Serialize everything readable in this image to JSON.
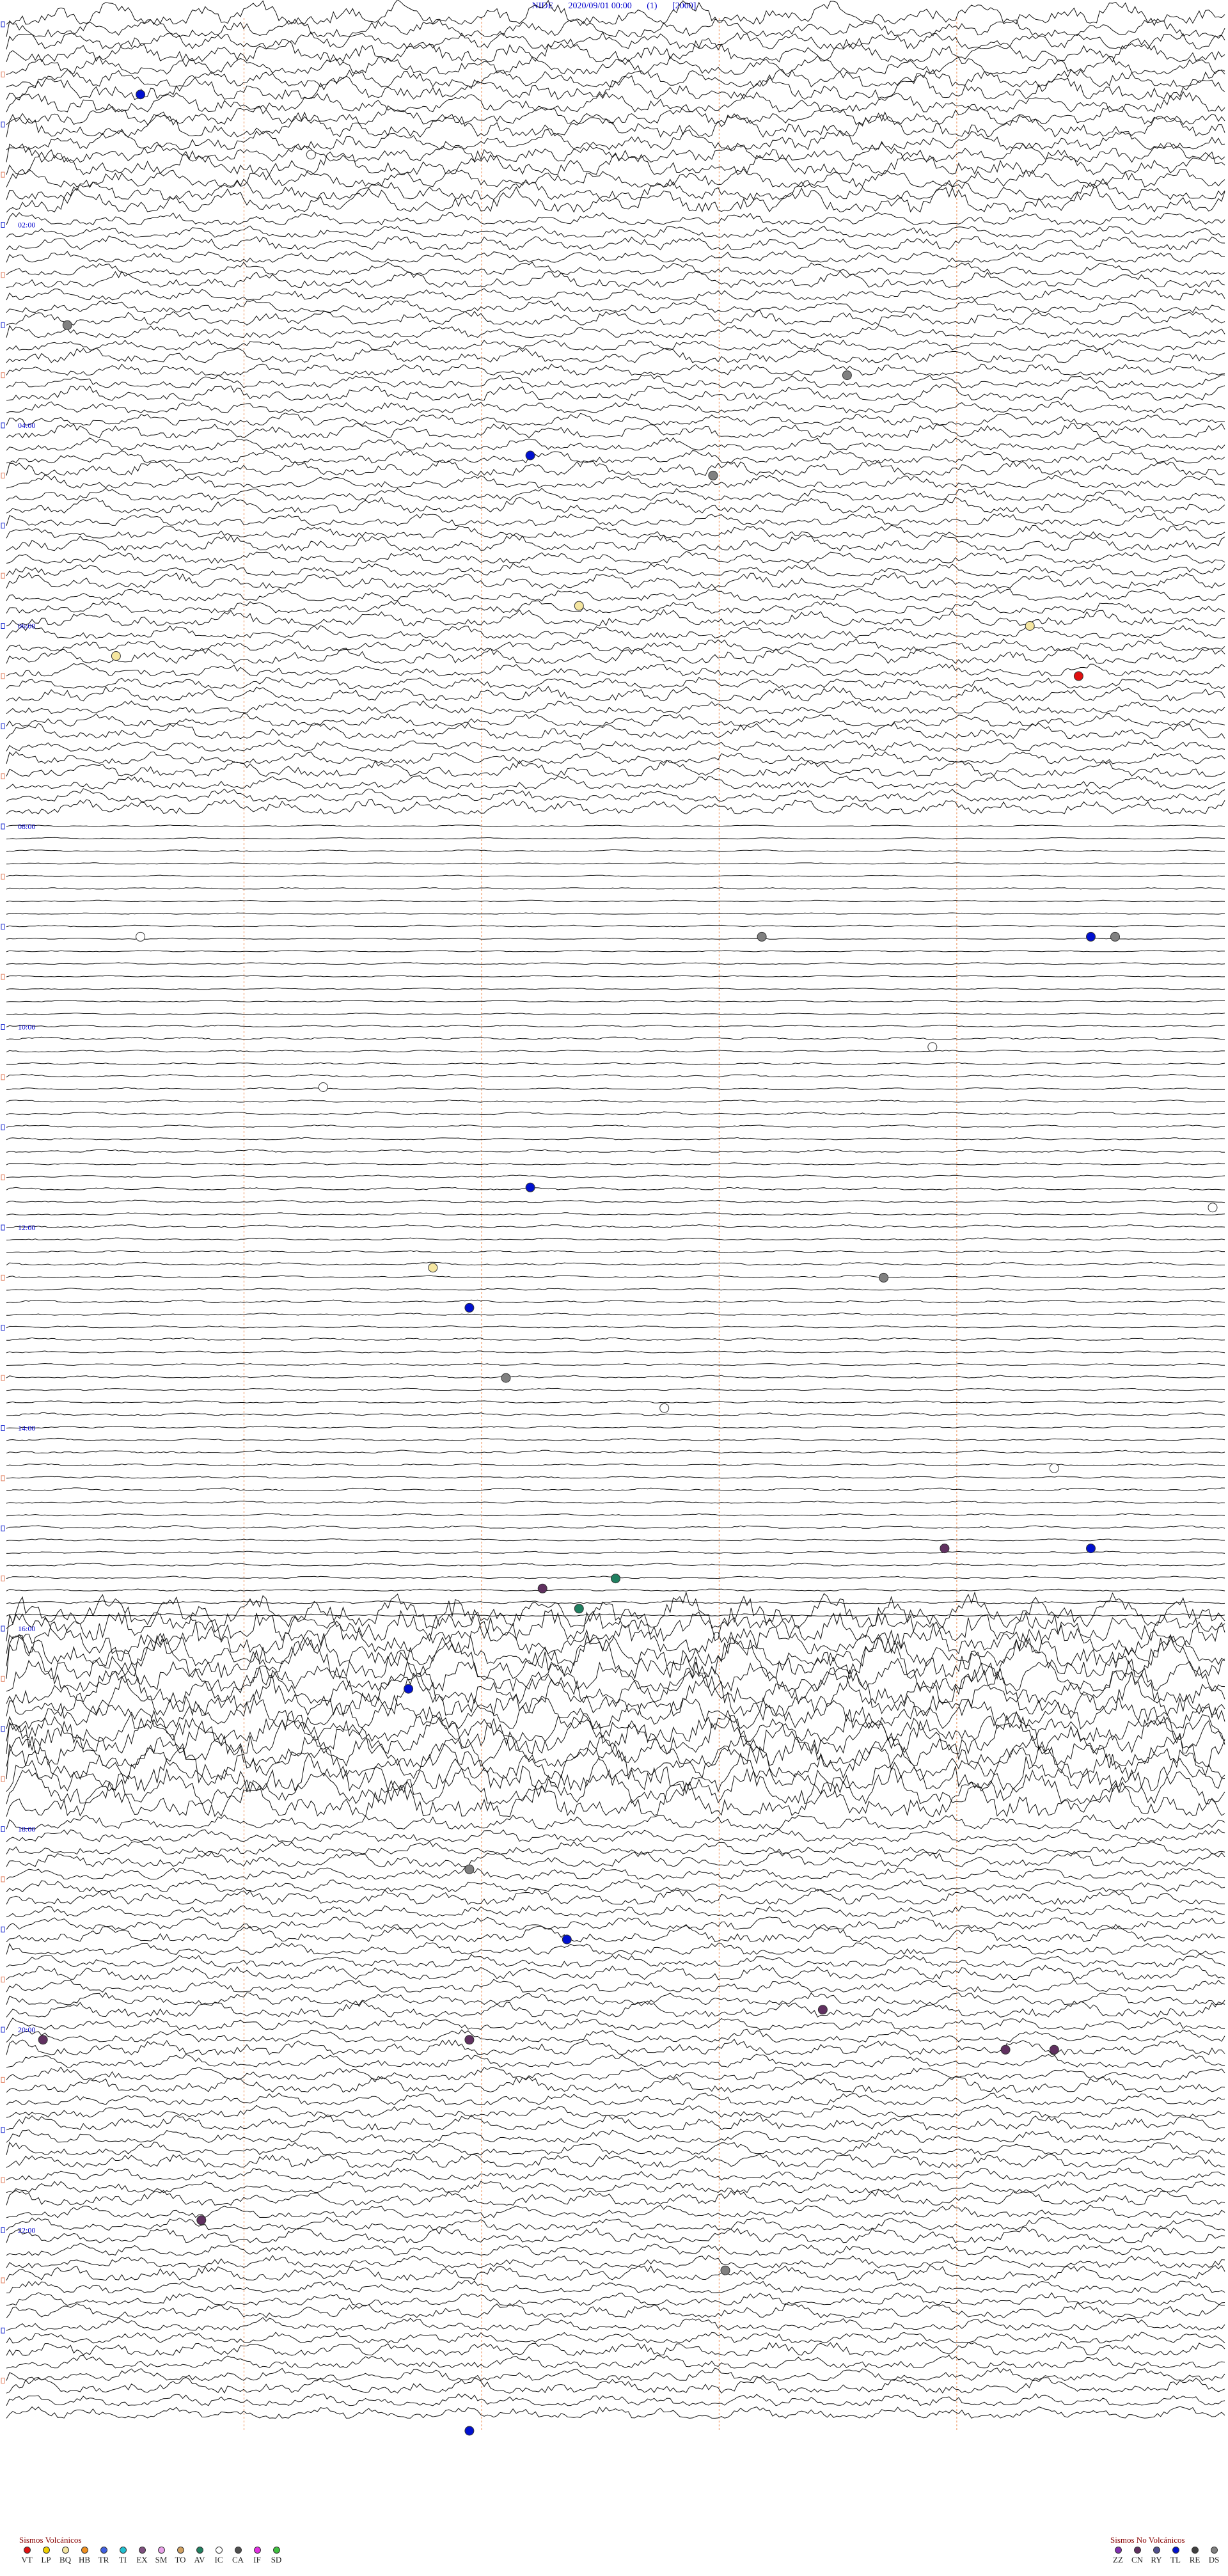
{
  "header": {
    "station": "NIDE",
    "datetime": "2020/09/01 00:00",
    "channel": "(1)",
    "scale": "[2000]"
  },
  "chart_data": {
    "type": "line",
    "description_ticks": [
      "02:00",
      "04:00",
      "06:00",
      "08:00",
      "10:00",
      "12:00",
      "14:00",
      "16:00",
      "18:00",
      "20:00",
      "22:00"
    ],
    "tick_hours": [
      2,
      4,
      6,
      8,
      10,
      12,
      14,
      16,
      18,
      20,
      22
    ],
    "rows_per_hour": 8,
    "total_rows": 192,
    "activity_profile": [
      {
        "from_hour": 0,
        "to_hour": 2,
        "amplitude": 0.55
      },
      {
        "from_hour": 2,
        "to_hour": 8,
        "amplitude": 0.35
      },
      {
        "from_hour": 8,
        "to_hour": 10,
        "amplitude": 0.05
      },
      {
        "from_hour": 10,
        "to_hour": 16,
        "amplitude": 0.08
      },
      {
        "from_hour": 16,
        "to_hour": 18,
        "amplitude": 1.0
      },
      {
        "from_hour": 18,
        "to_hour": 24,
        "amplitude": 0.35
      }
    ],
    "events": [
      {
        "hour": 0.7,
        "minute_frac": 0.11,
        "type": "TL"
      },
      {
        "hour": 4.3,
        "minute_frac": 0.43,
        "type": "TL"
      },
      {
        "hour": 6.5,
        "minute_frac": 0.88,
        "type": "VT"
      },
      {
        "hour": 9.1,
        "minute_frac": 0.89,
        "type": "TL"
      },
      {
        "hour": 11.6,
        "minute_frac": 0.43,
        "type": "TL"
      },
      {
        "hour": 12.8,
        "minute_frac": 0.38,
        "type": "TL"
      },
      {
        "hour": 15.2,
        "minute_frac": 0.89,
        "type": "TL"
      },
      {
        "hour": 16.6,
        "minute_frac": 0.33,
        "type": "TL"
      },
      {
        "hour": 19.1,
        "minute_frac": 0.46,
        "type": "TL"
      },
      {
        "hour": 24.0,
        "minute_frac": 0.38,
        "type": "TL"
      },
      {
        "hour": 15.5,
        "minute_frac": 0.5,
        "type": "AV"
      },
      {
        "hour": 15.8,
        "minute_frac": 0.47,
        "type": "AV"
      },
      {
        "hour": 15.2,
        "minute_frac": 0.77,
        "type": "CN"
      },
      {
        "hour": 15.6,
        "minute_frac": 0.44,
        "type": "CN"
      },
      {
        "hour": 19.8,
        "minute_frac": 0.67,
        "type": "CN"
      },
      {
        "hour": 20.1,
        "minute_frac": 0.03,
        "type": "CN"
      },
      {
        "hour": 20.1,
        "minute_frac": 0.38,
        "type": "CN"
      },
      {
        "hour": 20.2,
        "minute_frac": 0.82,
        "type": "CN"
      },
      {
        "hour": 20.2,
        "minute_frac": 0.86,
        "type": "CN"
      },
      {
        "hour": 21.9,
        "minute_frac": 0.16,
        "type": "CN"
      },
      {
        "hour": 1.3,
        "minute_frac": 0.25,
        "type": "IC"
      },
      {
        "hour": 9.1,
        "minute_frac": 0.11,
        "type": "IC"
      },
      {
        "hour": 10.2,
        "minute_frac": 0.76,
        "type": "IC"
      },
      {
        "hour": 10.6,
        "minute_frac": 0.26,
        "type": "IC"
      },
      {
        "hour": 11.8,
        "minute_frac": 0.99,
        "type": "IC"
      },
      {
        "hour": 13.8,
        "minute_frac": 0.54,
        "type": "IC"
      },
      {
        "hour": 14.4,
        "minute_frac": 0.86,
        "type": "IC"
      },
      {
        "hour": 3.0,
        "minute_frac": 0.05,
        "type": "DS"
      },
      {
        "hour": 3.5,
        "minute_frac": 0.69,
        "type": "DS"
      },
      {
        "hour": 4.5,
        "minute_frac": 0.58,
        "type": "DS"
      },
      {
        "hour": 5.8,
        "minute_frac": 0.47,
        "type": "BQ"
      },
      {
        "hour": 6.0,
        "minute_frac": 0.84,
        "type": "BQ"
      },
      {
        "hour": 6.3,
        "minute_frac": 0.09,
        "type": "BQ"
      },
      {
        "hour": 9.1,
        "minute_frac": 0.62,
        "type": "DS"
      },
      {
        "hour": 9.1,
        "minute_frac": 0.91,
        "type": "DS"
      },
      {
        "hour": 12.5,
        "minute_frac": 0.72,
        "type": "DS"
      },
      {
        "hour": 12.4,
        "minute_frac": 0.35,
        "type": "BQ"
      },
      {
        "hour": 13.5,
        "minute_frac": 0.41,
        "type": "DS"
      },
      {
        "hour": 18.4,
        "minute_frac": 0.38,
        "type": "DS"
      },
      {
        "hour": 22.4,
        "minute_frac": 0.59,
        "type": "DS"
      }
    ]
  },
  "legend_volcanic": {
    "title": "Sismos Volcánicos",
    "items": [
      {
        "label": "VT",
        "color": "#e01010"
      },
      {
        "label": "LP",
        "color": "#f0d000"
      },
      {
        "label": "BQ",
        "color": "#f5e6a0"
      },
      {
        "label": "HB",
        "color": "#f09020"
      },
      {
        "label": "TR",
        "color": "#4060e0"
      },
      {
        "label": "TI",
        "color": "#20c0d0"
      },
      {
        "label": "EX",
        "color": "#805080"
      },
      {
        "label": "SM",
        "color": "#e8a0e8"
      },
      {
        "label": "TO",
        "color": "#d0a060"
      },
      {
        "label": "AV",
        "color": "#208060"
      },
      {
        "label": "IC",
        "color": "#ffffff"
      },
      {
        "label": "CA",
        "color": "#505050"
      },
      {
        "label": "IF",
        "color": "#e030e0"
      },
      {
        "label": "SD",
        "color": "#40c040"
      }
    ]
  },
  "legend_nonvolcanic": {
    "title": "Sismos No Volcánicos",
    "items": [
      {
        "label": "ZZ",
        "color": "#8030b0"
      },
      {
        "label": "CN",
        "color": "#603060"
      },
      {
        "label": "RY",
        "color": "#505090"
      },
      {
        "label": "TL",
        "color": "#0010d0"
      },
      {
        "label": "RE",
        "color": "#404040"
      },
      {
        "label": "DS",
        "color": "#808080"
      }
    ]
  }
}
